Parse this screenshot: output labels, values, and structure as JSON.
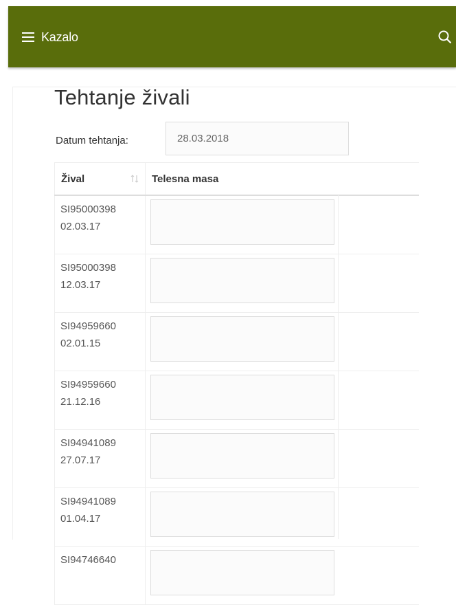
{
  "header": {
    "menu_label": "Kazalo",
    "menu_icon": "hamburger-icon",
    "search_icon": "search-icon",
    "bg_color": "#596d0b"
  },
  "page": {
    "title": "Tehtanje živali",
    "date_label": "Datum tehtanja:",
    "date_value": "28.03.2018"
  },
  "table": {
    "columns": [
      "Žival",
      "Telesna masa"
    ],
    "sort_icon": "sort-icon",
    "rows": [
      {
        "id": "SI95000398",
        "date": "02.03.17",
        "mass": ""
      },
      {
        "id": "SI95000398",
        "date": "12.03.17",
        "mass": ""
      },
      {
        "id": "SI94959660",
        "date": "02.01.15",
        "mass": ""
      },
      {
        "id": "SI94959660",
        "date": "21.12.16",
        "mass": ""
      },
      {
        "id": "SI94941089",
        "date": "27.07.17",
        "mass": ""
      },
      {
        "id": "SI94941089",
        "date": "01.04.17",
        "mass": ""
      },
      {
        "id": "SI94746640",
        "date": "",
        "mass": ""
      }
    ]
  }
}
